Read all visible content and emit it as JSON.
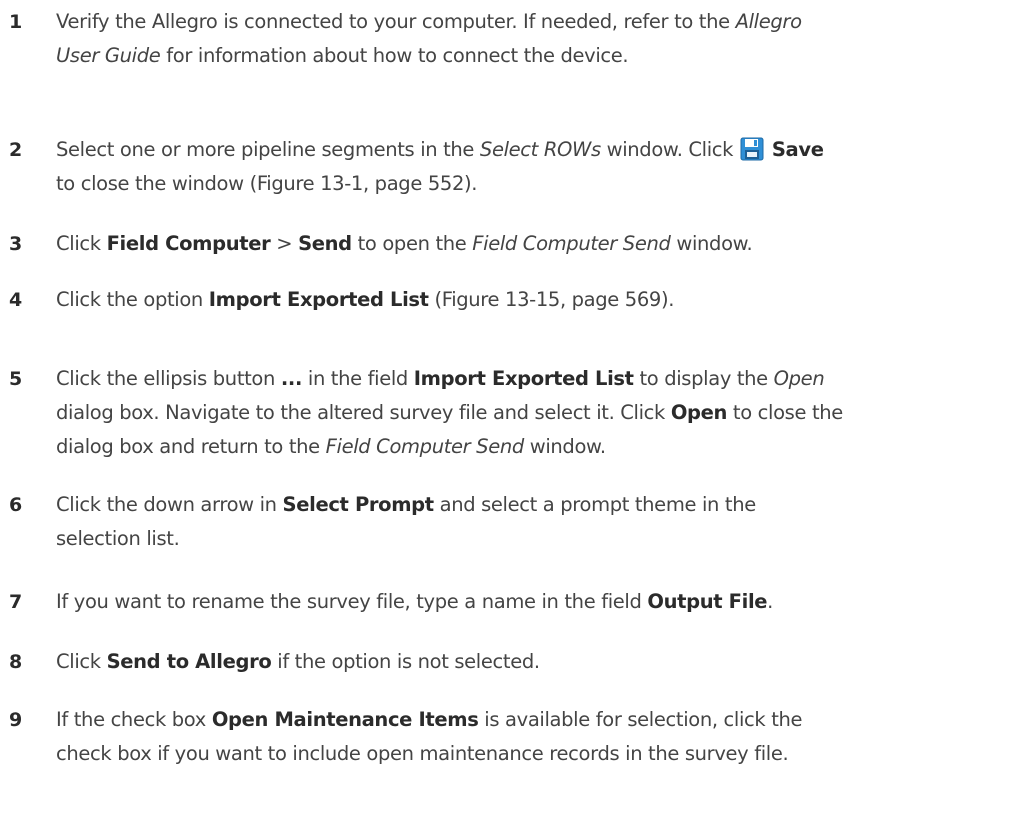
{
  "steps": [
    {
      "number": "1",
      "lines": [
        [
          {
            "t": "Verify the Allegro is connected to your computer. If needed, refer to the "
          },
          {
            "t": "Allegro",
            "s": "i"
          }
        ],
        [
          {
            "t": "User Guide",
            "s": "i"
          },
          {
            "t": " for information about how to connect the device."
          }
        ]
      ]
    },
    {
      "number": "2",
      "lines": [
        [
          {
            "t": "Select one or more pipeline segments in the "
          },
          {
            "t": "Select ROWs",
            "s": "i"
          },
          {
            "t": " window. Click "
          },
          {
            "icon": "save-icon"
          },
          {
            "t": " "
          },
          {
            "t": "Save",
            "s": "b"
          }
        ],
        [
          {
            "t": "to close the window (Figure 13-1, page 552)."
          }
        ]
      ]
    },
    {
      "number": "3",
      "lines": [
        [
          {
            "t": "Click "
          },
          {
            "t": "Field Computer",
            "s": "b"
          },
          {
            "t": " > "
          },
          {
            "t": "Send",
            "s": "b"
          },
          {
            "t": " to open the "
          },
          {
            "t": "Field Computer Send",
            "s": "i"
          },
          {
            "t": " window."
          }
        ]
      ]
    },
    {
      "number": "4",
      "lines": [
        [
          {
            "t": "Click the option "
          },
          {
            "t": "Import Exported List",
            "s": "b"
          },
          {
            "t": " (Figure 13-15, page 569)."
          }
        ]
      ]
    },
    {
      "number": "5",
      "lines": [
        [
          {
            "t": "Click the ellipsis button "
          },
          {
            "t": "...",
            "s": "b"
          },
          {
            "t": " in the field "
          },
          {
            "t": "Import Exported List",
            "s": "b"
          },
          {
            "t": " to display the "
          },
          {
            "t": "Open",
            "s": "i"
          }
        ],
        [
          {
            "t": "dialog box. Navigate to the altered survey file and select it. Click "
          },
          {
            "t": "Open",
            "s": "b"
          },
          {
            "t": " to close the"
          }
        ],
        [
          {
            "t": "dialog box and return to the "
          },
          {
            "t": "Field Computer Send",
            "s": "i"
          },
          {
            "t": " window."
          }
        ]
      ]
    },
    {
      "number": "6",
      "lines": [
        [
          {
            "t": "Click the down arrow in "
          },
          {
            "t": "Select Prompt",
            "s": "b"
          },
          {
            "t": " and select a prompt theme in the"
          }
        ],
        [
          {
            "t": "selection list."
          }
        ]
      ]
    },
    {
      "number": "7",
      "lines": [
        [
          {
            "t": "If you want to rename the survey file, type a name in the field "
          },
          {
            "t": "Output File",
            "s": "b"
          },
          {
            "t": "."
          }
        ]
      ]
    },
    {
      "number": "8",
      "lines": [
        [
          {
            "t": "Click "
          },
          {
            "t": "Send to Allegro",
            "s": "b"
          },
          {
            "t": " if the option is not selected."
          }
        ]
      ]
    },
    {
      "number": "9",
      "lines": [
        [
          {
            "t": "If the check box "
          },
          {
            "t": "Open Maintenance Items",
            "s": "b"
          },
          {
            "t": " is available for selection, click the"
          }
        ],
        [
          {
            "t": "check box if you want to include open maintenance records in the survey file."
          }
        ]
      ]
    }
  ],
  "colors": {
    "text": "#444444",
    "bold": "#2b2b2b",
    "save_icon_blue": "#2f8fd6"
  }
}
